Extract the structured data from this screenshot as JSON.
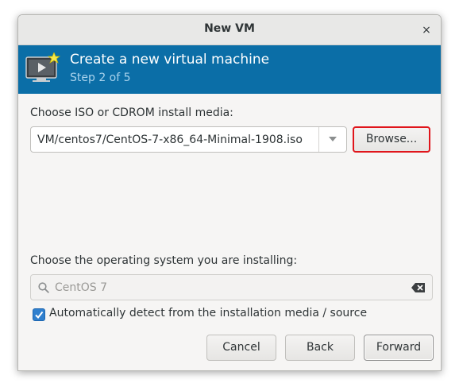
{
  "window": {
    "title": "New VM",
    "close_glyph": "×"
  },
  "header": {
    "title": "Create a new virtual machine",
    "step": "Step 2 of 5",
    "icon": "vm-monitor-icon",
    "background_color": "#0b6ea7"
  },
  "install_media": {
    "label": "Choose ISO or CDROM install media:",
    "value": "VM/centos7/CentOS-7-x86_64-Minimal-1908.iso",
    "browse_label": "Browse..."
  },
  "os_selection": {
    "label": "Choose the operating system you are installing:",
    "placeholder": "CentOS 7",
    "auto_detect_label": "Automatically detect from the installation media / source",
    "auto_detect_checked": true
  },
  "buttons": {
    "cancel": "Cancel",
    "back": "Back",
    "forward": "Forward"
  },
  "colors": {
    "highlight": "#e0151b",
    "checkbox": "#2f7fce"
  }
}
